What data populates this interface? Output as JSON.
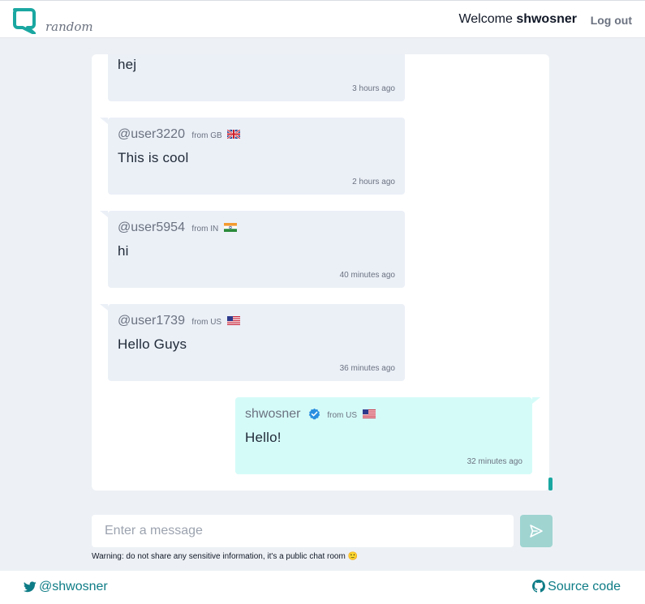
{
  "header": {
    "logo_text": "random",
    "welcome_prefix": "Welcome",
    "username": "shwosner",
    "logout_label": "Log out"
  },
  "messages": [
    {
      "user": "",
      "from": "",
      "text": "hej",
      "time": "3 hours ago",
      "mine": false,
      "flag": ""
    },
    {
      "user": "@user3220",
      "from": "from GB",
      "text": "This is cool",
      "time": "2 hours ago",
      "mine": false,
      "flag": "GB"
    },
    {
      "user": "@user5954",
      "from": "from IN",
      "text": "hi",
      "time": "40 minutes ago",
      "mine": false,
      "flag": "IN"
    },
    {
      "user": "@user1739",
      "from": "from US",
      "text": "Hello Guys",
      "time": "36 minutes ago",
      "mine": false,
      "flag": "US"
    },
    {
      "user": "shwosner",
      "from": "from US",
      "text": "Hello!",
      "time": "32 minutes ago",
      "mine": true,
      "flag": "US",
      "verified": true
    }
  ],
  "composer": {
    "placeholder": "Enter a message",
    "warning": "Warning: do not share any sensitive information, it's a public chat room 🙂"
  },
  "footer": {
    "twitter_handle": "@shwosner",
    "source_label": "Source code"
  },
  "colors": {
    "accent": "#1aa7a1",
    "brand_text": "#0e7c86",
    "other_bubble": "#ebf0f7",
    "my_bubble": "#d5fbf8",
    "send_button": "#9fd4d1"
  }
}
